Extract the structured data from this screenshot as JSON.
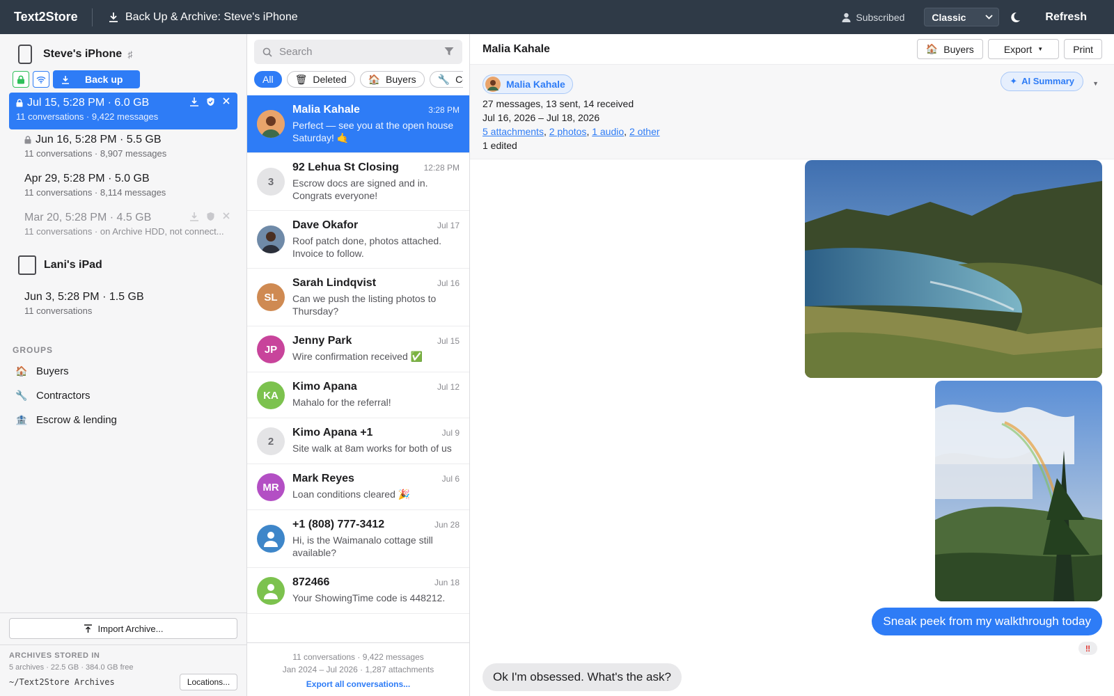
{
  "topbar": {
    "app_name": "Text2Store",
    "title": "Back Up & Archive: Steve's iPhone",
    "subscribed": "Subscribed",
    "style_select": "Classic",
    "refresh": "Refresh"
  },
  "sidebar": {
    "device1": {
      "name": "Steve's iPhone",
      "extra": "♯"
    },
    "backup_label": "Back up",
    "archives": [
      {
        "title": "Jul 15, 5:28 PM · 6.0 GB",
        "sub": "11 conversations · 9,422 messages"
      },
      {
        "title": "Jun 16, 5:28 PM · 5.5 GB",
        "sub": "11 conversations · 8,907 messages"
      },
      {
        "title": "Apr 29, 5:28 PM · 5.0 GB",
        "sub": "11 conversations · 8,114 messages"
      },
      {
        "title": "Mar 20, 5:28 PM · 4.5 GB",
        "sub": "11 conversations · on Archive HDD, not connect..."
      }
    ],
    "device2": {
      "name": "Lani's iPad"
    },
    "device2_archive": {
      "title": "Jun 3, 5:28 PM · 1.5 GB",
      "sub": "11 conversations"
    },
    "groups_heading": "GROUPS",
    "groups": [
      {
        "icon": "🏠",
        "label": "Buyers"
      },
      {
        "icon": "🔧",
        "label": "Contractors"
      },
      {
        "icon": "🏦",
        "label": "Escrow & lending"
      }
    ],
    "import_label": "Import Archive...",
    "stored_heading": "ARCHIVES STORED IN",
    "stored_sub": "5 archives · 22.5 GB · 384.0 GB free",
    "stored_path": "~/Text2Store Archives",
    "locations_label": "Locations..."
  },
  "middle": {
    "search_placeholder": "Search",
    "chips": [
      {
        "label": "All"
      },
      {
        "icon": "🗑",
        "label": "Deleted"
      },
      {
        "icon": "🏠",
        "label": "Buyers"
      },
      {
        "icon": "🔧",
        "label": "Co"
      }
    ],
    "conversations": [
      {
        "name": "Malia Kahale",
        "time": "3:28 PM",
        "preview": "Perfect — see you at the open house Saturday! 🤙"
      },
      {
        "name": "92 Lehua St Closing",
        "time": "12:28 PM",
        "preview": "Escrow docs are signed and in. Congrats everyone!",
        "initials": "3"
      },
      {
        "name": "Dave Okafor",
        "time": "Jul 17",
        "preview": "Roof patch done, photos attached. Invoice to follow."
      },
      {
        "name": "Sarah Lindqvist",
        "time": "Jul 16",
        "preview": "Can we push the listing photos to Thursday?",
        "initials": "SL"
      },
      {
        "name": "Jenny Park",
        "time": "Jul 15",
        "preview": "Wire confirmation received ✅",
        "initials": "JP"
      },
      {
        "name": "Kimo Apana",
        "time": "Jul 12",
        "preview": "Mahalo for the referral!",
        "initials": "KA"
      },
      {
        "name": "Kimo Apana +1",
        "time": "Jul 9",
        "preview": "Site walk at 8am works for both of us",
        "initials": "2"
      },
      {
        "name": "Mark Reyes",
        "time": "Jul 6",
        "preview": "Loan conditions cleared 🎉",
        "initials": "MR"
      },
      {
        "name": "+1 (808) 777-3412",
        "time": "Jun 28",
        "preview": "Hi, is the Waimanalo cottage still available?"
      },
      {
        "name": "872466",
        "time": "Jun 18",
        "preview": "Your ShowingTime code is 448212."
      }
    ],
    "footer_line1": "11 conversations · 9,422 messages",
    "footer_line2": "Jan 2024 – Jul 2026 · 1,287 attachments",
    "footer_link": "Export all conversations..."
  },
  "detail": {
    "title": "Malia Kahale",
    "buttons": {
      "buyers": "Buyers",
      "buyers_icon": "🏠",
      "export": "Export",
      "print": "Print"
    },
    "person_chip": "Malia Kahale",
    "ai_summary": "AI Summary",
    "stats": "27 messages, 13 sent, 14 received",
    "date_range": "Jul 16, 2026 – Jul 18, 2026",
    "links": [
      "5 attachments",
      "2 photos",
      "1 audio",
      "2 other"
    ],
    "edited": "1 edited",
    "outgoing": "Sneak peek from my walkthrough today",
    "reaction": "‼",
    "incoming": "Ok I'm obsessed. What's the ask?"
  },
  "colors": {
    "accent": "#2e7cf6",
    "topbar": "#2f3a47"
  }
}
